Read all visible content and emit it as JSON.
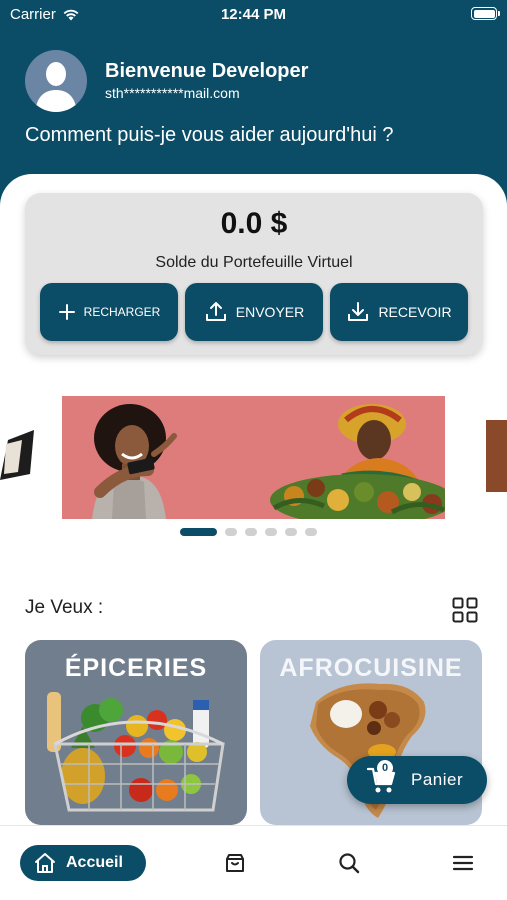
{
  "status_bar": {
    "carrier": "Carrier",
    "time": "12:44 PM",
    "icons": [
      "wifi-icon",
      "battery-icon"
    ]
  },
  "header": {
    "welcome": "Bienvenue Developer",
    "email": "sth***********mail.com",
    "question": "Comment puis-je vous aider aujourd'hui ?",
    "avatar_icon": "user-avatar-icon"
  },
  "wallet": {
    "balance": "0.0 $",
    "label": "Solde du Portefeuille Virtuel",
    "buttons": {
      "recharger": {
        "label": "RECHARGER",
        "icon": "plus-icon"
      },
      "envoyer": {
        "label": "ENVOYER",
        "icon": "upload-icon"
      },
      "recevoir": {
        "label": "RECEVOIR",
        "icon": "download-icon"
      }
    }
  },
  "carousel": {
    "slide_count": 6,
    "active_index": 0
  },
  "section": {
    "title": "Je Veux :",
    "toggle_icon": "grid-icon"
  },
  "categories": [
    {
      "title": "ÉPICERIES"
    },
    {
      "title": "AFROCUISINE"
    }
  ],
  "cart": {
    "label": "Panier",
    "count": "0",
    "icon": "cart-icon"
  },
  "bottom_nav": {
    "home_label": "Accueil",
    "items": [
      "home-icon",
      "shop-icon",
      "search-icon",
      "menu-icon"
    ]
  },
  "colors": {
    "primary": "#0b4d66",
    "card_bg": "#e3e3e3",
    "banner_bg": "#de7c7c",
    "epiceries_bg": "#717e8d",
    "afrocuisine_bg": "#b8c4d3"
  }
}
